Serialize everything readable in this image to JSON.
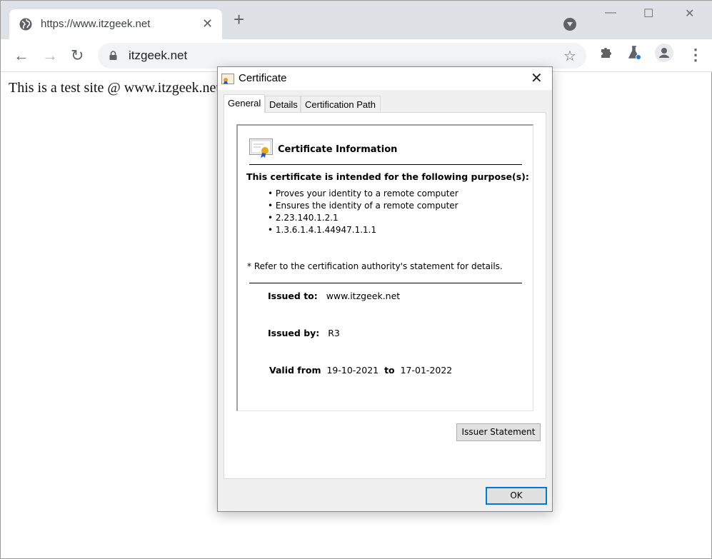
{
  "browser": {
    "tab": {
      "title": "https://www.itzgeek.net",
      "icon": "globe-icon"
    },
    "omnibox": {
      "url": "itzgeek.net"
    },
    "window_controls": {
      "minimize": "—",
      "maximize": "☐",
      "close": "✕"
    },
    "nav": {
      "back": "←",
      "forward": "→",
      "reload": "↻"
    },
    "new_tab": "+",
    "tab_close": "✕",
    "star": "☆",
    "menu": "⋮"
  },
  "page": {
    "text": "This is a test site @ www.itzgeek.net"
  },
  "dialog": {
    "title": "Certificate",
    "close": "✕",
    "tabs": [
      {
        "label": "General",
        "active": true
      },
      {
        "label": "Details",
        "active": false
      },
      {
        "label": "Certification Path",
        "active": false
      }
    ],
    "heading": "Certificate Information",
    "purpose_heading": "This certificate is intended for the following purpose(s):",
    "purposes": [
      "Proves your identity to a remote computer",
      "Ensures the identity of a remote computer",
      "2.23.140.1.2.1",
      "1.3.6.1.4.1.44947.1.1.1"
    ],
    "refer_note": "* Refer to the certification authority's statement for details.",
    "issued_to_label": "Issued to:",
    "issued_to": "www.itzgeek.net",
    "issued_by_label": "Issued by:",
    "issued_by": "R3",
    "valid_from_label": "Valid from",
    "valid_from": "19-10-2021",
    "to_label": "to",
    "valid_to": "17-01-2022",
    "issuer_statement_button": "Issuer Statement",
    "ok_button": "OK"
  }
}
